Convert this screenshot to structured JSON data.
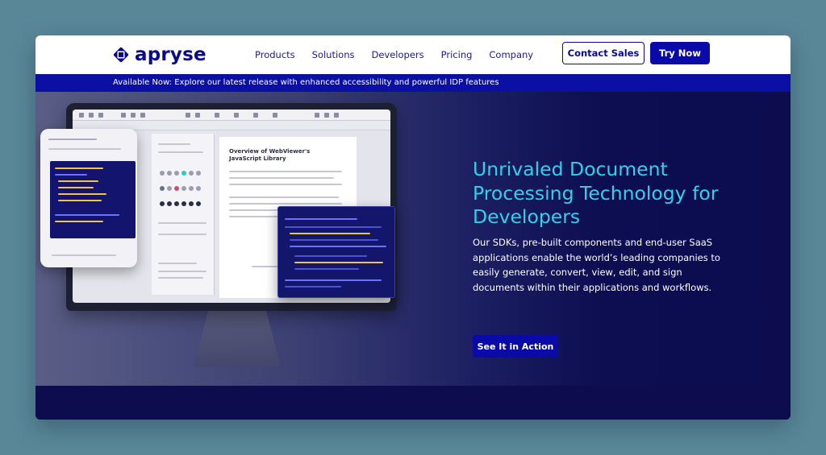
{
  "header": {
    "logo_text": "apryse",
    "nav": [
      "Products",
      "Solutions",
      "Developers",
      "Pricing",
      "Company"
    ],
    "contact_label": "Contact Sales",
    "try_label": "Try Now"
  },
  "announcement": {
    "text": "Available Now: Explore our latest release with enhanced accessibility and powerful IDP features"
  },
  "hero": {
    "title": "Unrivaled Document Processing Technology for Developers",
    "description": "Our SDKs, pre-built components and end-user SaaS applications enable the world’s leading companies to easily generate, convert, view, edit, and sign documents within their applications and workflows.",
    "cta_label": "See It in Action",
    "illustration": {
      "page_title": "Overview of WebViewer's JavaScript Library"
    }
  },
  "colors": {
    "brand": "#0a0a8f",
    "accent": "#33d1e9",
    "announce_bg": "#0b0fa3",
    "hero_bg": "#0c0c4f",
    "page_bg": "#5a8797"
  }
}
